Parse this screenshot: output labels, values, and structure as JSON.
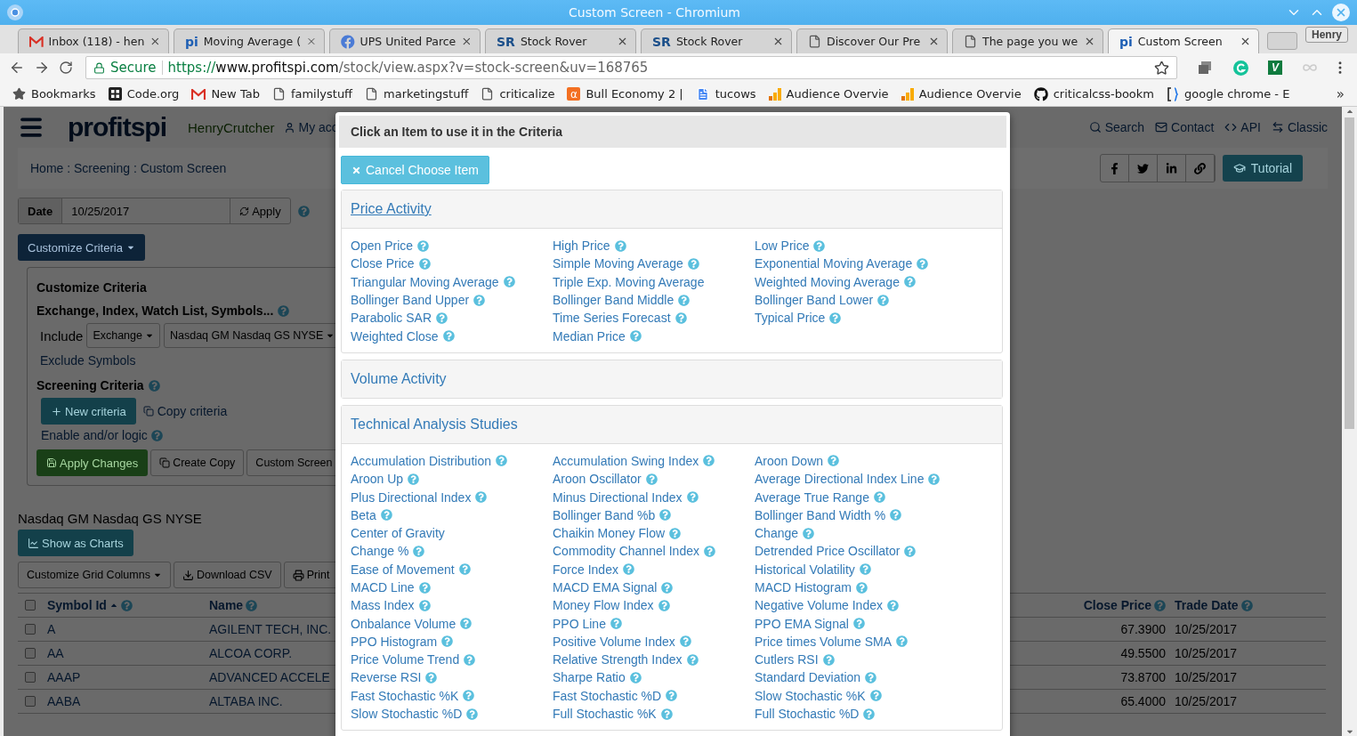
{
  "browser": {
    "title": "Custom Screen - Chromium",
    "tabs": [
      {
        "label": "Inbox (118) - hen",
        "kind": "gmail",
        "selected": false
      },
      {
        "label": "Moving Average (",
        "kind": "text",
        "icon_text": "pi",
        "selected": false
      },
      {
        "label": "UPS United Parce",
        "kind": "facebook",
        "selected": false
      },
      {
        "label": "Stock Rover",
        "kind": "text2",
        "icon_text": "SR",
        "selected": false
      },
      {
        "label": "Stock Rover",
        "kind": "text2",
        "icon_text": "SR",
        "selected": false
      },
      {
        "label": "Discover Our Pre",
        "kind": "page",
        "selected": false
      },
      {
        "label": "The page you we",
        "kind": "page",
        "selected": false
      },
      {
        "label": "Custom Screen",
        "kind": "text",
        "icon_text": "pi",
        "selected": true
      }
    ],
    "profile": "Henry",
    "address": {
      "secure": "Secure",
      "scheme": "https://",
      "host": "www.profitspi.com",
      "path": "/stock/view.aspx?v=stock-screen&uv=168765"
    },
    "extensions": [
      {
        "kind": "stack"
      },
      {
        "kind": "grammarly"
      },
      {
        "kind": "badge",
        "text": "V"
      },
      {
        "kind": "infinity"
      }
    ],
    "bookmarks": [
      {
        "label": "Bookmarks",
        "kind": "star"
      },
      {
        "label": "Code.org",
        "kind": "grid"
      },
      {
        "label": "New Tab",
        "kind": "gmail"
      },
      {
        "label": "familystuff",
        "kind": "page"
      },
      {
        "label": "marketingstuff",
        "kind": "page"
      },
      {
        "label": "criticalize",
        "kind": "page"
      },
      {
        "label": "Bull Economy 2 |",
        "kind": "alpha",
        "icon_text": "α"
      },
      {
        "label": "tucows",
        "kind": "doc"
      },
      {
        "label": "Audience Overvie",
        "kind": "analytics"
      },
      {
        "label": "Audience Overvie",
        "kind": "analytics"
      },
      {
        "label": "criticalcss-bookm",
        "kind": "github"
      },
      {
        "label": "google chrome - E",
        "kind": "bracket"
      }
    ],
    "bookmarks_more": "»"
  },
  "page": {
    "nav": {
      "logo": "profitspi",
      "user": "HenryCrutcher",
      "account": "My acc",
      "links": [
        {
          "kind": "search",
          "label": "Search"
        },
        {
          "kind": "contact",
          "label": "Contact"
        },
        {
          "kind": "api",
          "label": "API"
        },
        {
          "kind": "classic",
          "label": "Classic"
        }
      ]
    },
    "breadcrumb": "Home : Screening : Custom Screen",
    "social": [
      {
        "kind": "facebook"
      },
      {
        "kind": "twitter"
      },
      {
        "kind": "linkedin"
      },
      {
        "kind": "link"
      }
    ],
    "tutorial": "Tutorial",
    "date": {
      "label": "Date",
      "value": "10/25/2017",
      "apply": "Apply"
    },
    "customize_button": "Customize Criteria",
    "criteria_panel": {
      "title": "Customize Criteria",
      "exchange_heading": "Exchange, Index, Watch List, Symbols...",
      "include_label": "Include",
      "include_type": "Exchange",
      "include_value": "Nasdaq GM Nasdaq GS NYSE",
      "exclude_link": "Exclude Symbols",
      "screening_heading": "Screening Criteria",
      "new_criteria": "New criteria",
      "copy_criteria": "Copy criteria",
      "logic_link": "Enable and/or logic",
      "apply_changes": "Apply Changes",
      "create_copy": "Create Copy",
      "screen_name": "Custom Screen"
    },
    "results_heading": "Nasdaq GM Nasdaq GS NYSE",
    "show_charts": "Show as Charts",
    "grid_toolbar": [
      {
        "kind": "dropdown",
        "label": "Customize Grid Columns"
      },
      {
        "kind": "download",
        "label": "Download CSV"
      },
      {
        "kind": "print",
        "label": "Print"
      }
    ],
    "table": {
      "header_checked": false,
      "columns": [
        {
          "label": "Symbol Id",
          "sorted": true
        },
        {
          "label": "Name",
          "sorted": false
        },
        {
          "label": "Close Price",
          "sorted": false
        },
        {
          "label": "Trade Date",
          "sorted": false
        }
      ],
      "rows": [
        {
          "checked": false,
          "symbol": "A",
          "name": "AGILENT TECH, INC.",
          "close_price": "67.3900",
          "trade_date": "10/25/2017"
        },
        {
          "checked": false,
          "symbol": "AA",
          "name": "ALCOA CORP.",
          "close_price": "49.5500",
          "trade_date": "10/25/2017"
        },
        {
          "checked": false,
          "symbol": "AAAP",
          "name": "ADVANCED ACCELE",
          "close_price": "73.8700",
          "trade_date": "10/25/2017"
        },
        {
          "checked": false,
          "symbol": "AABA",
          "name": "ALTABA INC.",
          "close_price": "65.4000",
          "trade_date": "10/25/2017"
        }
      ]
    }
  },
  "dialog": {
    "title": "Click an Item to use it in the Criteria",
    "cancel": "Cancel Choose Item",
    "sections": [
      {
        "title": "Price Activity",
        "underlined": true,
        "expanded": true,
        "items": [
          {
            "label": "Open Price",
            "help": true
          },
          {
            "label": "High Price",
            "help": true
          },
          {
            "label": "Low Price",
            "help": true
          },
          {
            "label": "Close Price",
            "help": true
          },
          {
            "label": "Simple Moving Average",
            "help": true
          },
          {
            "label": "Exponential Moving Average",
            "help": true
          },
          {
            "label": "Triangular Moving Average",
            "help": true
          },
          {
            "label": "Triple Exp. Moving Average",
            "help": false
          },
          {
            "label": "Weighted Moving Average",
            "help": true
          },
          {
            "label": "Bollinger Band Upper",
            "help": true
          },
          {
            "label": "Bollinger Band Middle",
            "help": true
          },
          {
            "label": "Bollinger Band Lower",
            "help": true
          },
          {
            "label": "Parabolic SAR",
            "help": true
          },
          {
            "label": "Time Series Forecast",
            "help": true
          },
          {
            "label": "Typical Price",
            "help": true
          },
          {
            "label": "Weighted Close",
            "help": true
          },
          {
            "label": "Median Price",
            "help": true
          }
        ]
      },
      {
        "title": "Volume Activity",
        "underlined": false,
        "expanded": false
      },
      {
        "title": "Technical Analysis Studies",
        "underlined": false,
        "expanded": true,
        "items": [
          {
            "label": "Accumulation Distribution",
            "help": true
          },
          {
            "label": "Accumulation Swing Index",
            "help": true
          },
          {
            "label": "Aroon Down",
            "help": true
          },
          {
            "label": "Aroon Up",
            "help": true
          },
          {
            "label": "Aroon Oscillator",
            "help": true
          },
          {
            "label": "Average Directional Index Line",
            "help": true
          },
          {
            "label": "Plus Directional Index",
            "help": true
          },
          {
            "label": "Minus Directional Index",
            "help": true
          },
          {
            "label": "Average True Range",
            "help": true
          },
          {
            "label": "Beta",
            "help": true
          },
          {
            "label": "Bollinger Band %b",
            "help": true
          },
          {
            "label": "Bollinger Band Width %",
            "help": true
          },
          {
            "label": "Center of Gravity",
            "help": false
          },
          {
            "label": "Chaikin Money Flow",
            "help": true
          },
          {
            "label": "Change",
            "help": true
          },
          {
            "label": "Change %",
            "help": true
          },
          {
            "label": "Commodity Channel Index",
            "help": true
          },
          {
            "label": "Detrended Price Oscillator",
            "help": true
          },
          {
            "label": "Ease of Movement",
            "help": true
          },
          {
            "label": "Force Index",
            "help": true
          },
          {
            "label": "Historical Volatility",
            "help": true
          },
          {
            "label": "MACD Line",
            "help": true
          },
          {
            "label": "MACD EMA Signal",
            "help": true
          },
          {
            "label": "MACD Histogram",
            "help": true
          },
          {
            "label": "Mass Index",
            "help": true
          },
          {
            "label": "Money Flow Index",
            "help": true
          },
          {
            "label": "Negative Volume Index",
            "help": true
          },
          {
            "label": "Onbalance Volume",
            "help": true
          },
          {
            "label": "PPO Line",
            "help": true
          },
          {
            "label": "PPO EMA Signal",
            "help": true
          },
          {
            "label": "PPO Histogram",
            "help": true
          },
          {
            "label": "Positive Volume Index",
            "help": true
          },
          {
            "label": "Price times Volume SMA",
            "help": true
          },
          {
            "label": "Price Volume Trend",
            "help": true
          },
          {
            "label": "Relative Strength Index",
            "help": true
          },
          {
            "label": "Cutlers RSI",
            "help": true
          },
          {
            "label": "Reverse RSI",
            "help": true
          },
          {
            "label": "Sharpe Ratio",
            "help": true
          },
          {
            "label": "Standard Deviation",
            "help": true
          },
          {
            "label": "Fast Stochastic %K",
            "help": true
          },
          {
            "label": "Fast Stochastic %D",
            "help": true
          },
          {
            "label": "Slow Stochastic %K",
            "help": true
          },
          {
            "label": "Slow Stochastic %D",
            "help": true
          },
          {
            "label": "Full Stochastic %K",
            "help": true
          },
          {
            "label": "Full Stochastic %D",
            "help": true
          }
        ]
      }
    ]
  }
}
